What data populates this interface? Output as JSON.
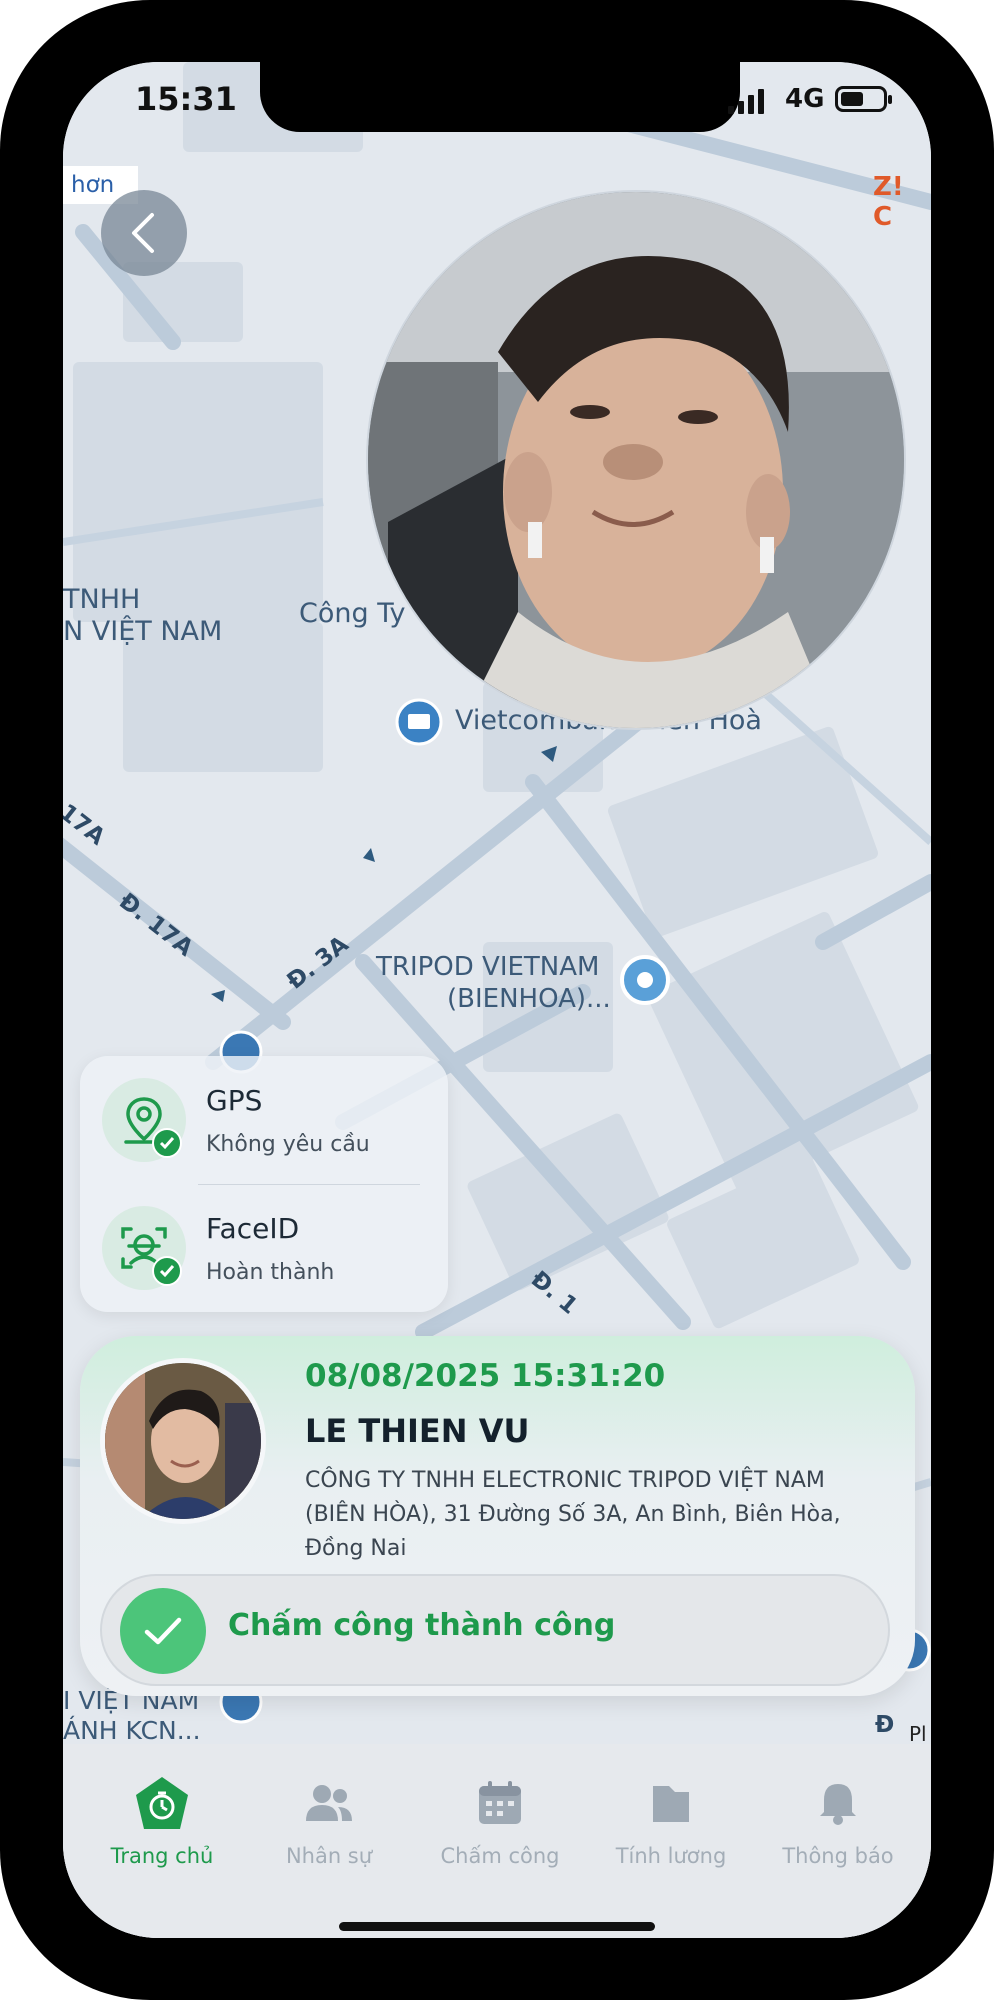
{
  "status_bar": {
    "time": "15:31",
    "network": "4G"
  },
  "map": {
    "partial_tag_left": "hơn",
    "partial_tag_right": "Z! C",
    "labels": {
      "company_left_1": "TNHH",
      "company_left_2": "N VIỆT NAM",
      "cong_ty": "Công Ty",
      "bank": "Vietcombank Biên Hoà",
      "tripod_1": "TRIPOD VIETNAM",
      "tripod_2": "(BIENHOA)...",
      "road_17a_a": "17A",
      "road_17a_b": "Đ. 17A",
      "road_3a": "Đ. 3A",
      "road_partial": "Đ. 1",
      "bottom_left_1": "I VIỆT NAM",
      "bottom_left_2": "ÁNH KCN...",
      "bottom_right": "Đ",
      "bottom_right_2": "Pl"
    }
  },
  "verification": {
    "gps": {
      "title": "GPS",
      "status": "Không yêu cầu"
    },
    "face": {
      "title": "FaceID",
      "status": "Hoàn thành"
    }
  },
  "result": {
    "datetime": "08/08/2025 15:31:20",
    "name": "LE THIEN VU",
    "address": "CÔNG TY TNHH ELECTRONIC TRIPOD VIỆT NAM (BIÊN HÒA), 31 Đường Số 3A, An Bình, Biên Hòa, Đồng Nai",
    "success_message": "Chấm công thành công"
  },
  "nav": {
    "items": [
      {
        "label": "Trang chủ",
        "icon": "home-timer-icon",
        "active": true
      },
      {
        "label": "Nhân sự",
        "icon": "people-icon"
      },
      {
        "label": "Chấm công",
        "icon": "calendar-icon"
      },
      {
        "label": "Tính lương",
        "icon": "folder-icon"
      },
      {
        "label": "Thông báo",
        "icon": "bell-icon"
      }
    ]
  },
  "colors": {
    "accent_green": "#1e9a4c",
    "map_bg": "#e3e8ee",
    "road": "#b8c8d8"
  }
}
